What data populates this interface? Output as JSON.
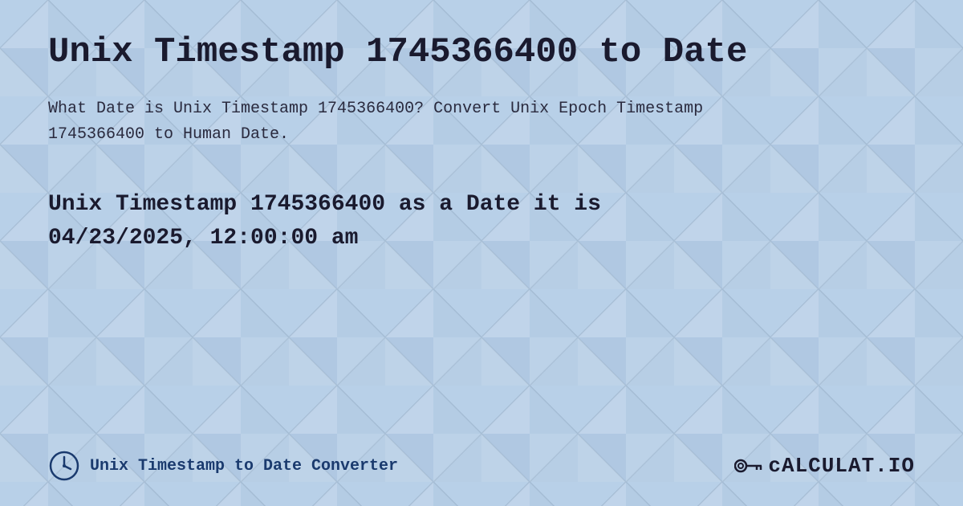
{
  "page": {
    "title": "Unix Timestamp 1745366400 to Date",
    "description": "What Date is Unix Timestamp 1745366400? Convert Unix Epoch Timestamp 1745366400 to Human Date.",
    "result_line1": "Unix Timestamp 1745366400 as a Date it is",
    "result_line2": "04/23/2025, 12:00:00 am",
    "footer_label": "Unix Timestamp to Date Converter",
    "logo_text": "cALCULAT.IO"
  },
  "colors": {
    "background": "#b8cfe0",
    "title": "#1a1a2e",
    "text": "#2a2a3e",
    "accent": "#1a3a6e"
  }
}
